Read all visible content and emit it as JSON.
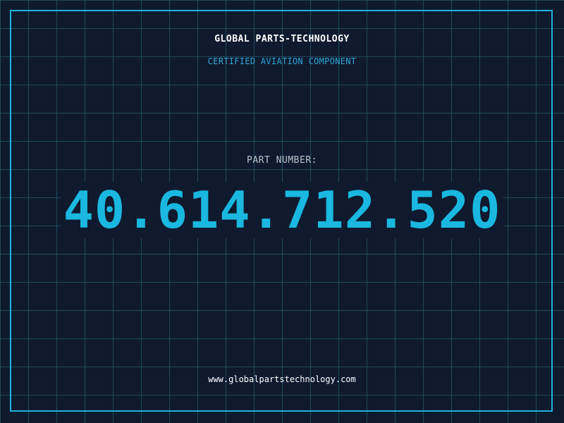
{
  "header": {
    "brand": "GLOBAL PARTS-TECHNOLOGY",
    "subtitle": "CERTIFIED AVIATION COMPONENT"
  },
  "part": {
    "label": "PART NUMBER:",
    "number": "40.614.712.520"
  },
  "footer": {
    "url": "www.globalpartstechnology.com"
  },
  "colors": {
    "background": "#0f1a2e",
    "grid": "#1e4a5e",
    "accent": "#1ab8e0",
    "frame": "#1eb4d8"
  }
}
